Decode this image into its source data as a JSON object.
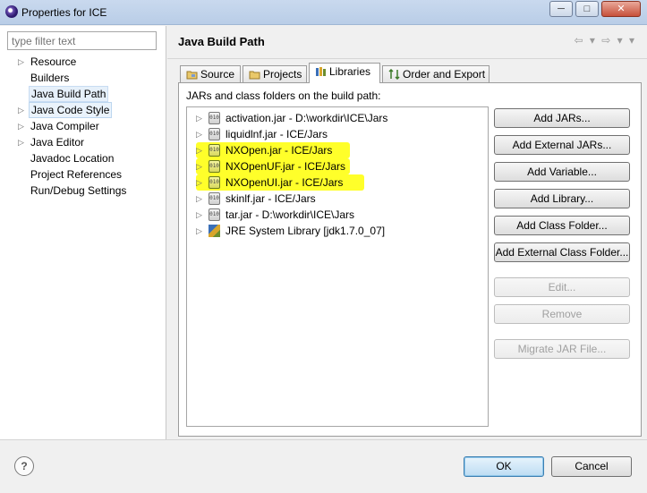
{
  "window": {
    "title": "Properties for ICE",
    "min_label": "─",
    "max_label": "□",
    "close_label": "✕"
  },
  "filter": {
    "placeholder": "type filter text"
  },
  "nav_tree": [
    {
      "label": "Resource",
      "expandable": true
    },
    {
      "label": "Builders",
      "expandable": false
    },
    {
      "label": "Java Build Path",
      "expandable": false,
      "selected": true
    },
    {
      "label": "Java Code Style",
      "expandable": true
    },
    {
      "label": "Java Compiler",
      "expandable": true
    },
    {
      "label": "Java Editor",
      "expandable": true
    },
    {
      "label": "Javadoc Location",
      "expandable": false
    },
    {
      "label": "Project References",
      "expandable": false
    },
    {
      "label": "Run/Debug Settings",
      "expandable": false
    }
  ],
  "page": {
    "title": "Java Build Path",
    "nav_icons": "⇦ ▾ ⇨ ▾ ▾"
  },
  "tabs": [
    {
      "label": "Source",
      "icon": "source-folder-icon"
    },
    {
      "label": "Projects",
      "icon": "projects-folder-icon"
    },
    {
      "label": "Libraries",
      "icon": "libraries-icon",
      "active": true
    },
    {
      "label": "Order and Export",
      "icon": "order-export-icon"
    }
  ],
  "libraries": {
    "label": "JARs and class folders on the build path:",
    "jar_icon_text": "010",
    "items": [
      {
        "label": "activation.jar - D:\\workdir\\ICE\\Jars",
        "highlighted": false
      },
      {
        "label": "liquidlnf.jar - ICE/Jars",
        "highlighted": false
      },
      {
        "label": "NXOpen.jar - ICE/Jars",
        "highlighted": true
      },
      {
        "label": "NXOpenUF.jar - ICE/Jars",
        "highlighted": true
      },
      {
        "label": "NXOpenUI.jar - ICE/Jars",
        "highlighted": true
      },
      {
        "label": "skinlf.jar - ICE/Jars",
        "highlighted": false
      },
      {
        "label": "tar.jar - D:\\workdir\\ICE\\Jars",
        "highlighted": false
      },
      {
        "label": "JRE System Library [jdk1.7.0_07]",
        "highlighted": false,
        "jre": true
      }
    ],
    "highlight_color": "#ffff2a"
  },
  "buttons": {
    "add_jars": "Add JARs...",
    "add_external_jars": "Add External JARs...",
    "add_variable": "Add Variable...",
    "add_library": "Add Library...",
    "add_class_folder": "Add Class Folder...",
    "add_external_class_folder": "Add External Class Folder...",
    "edit": "Edit...",
    "remove": "Remove",
    "migrate_jar": "Migrate JAR File..."
  },
  "dialog": {
    "help": "?",
    "ok": "OK",
    "cancel": "Cancel"
  }
}
